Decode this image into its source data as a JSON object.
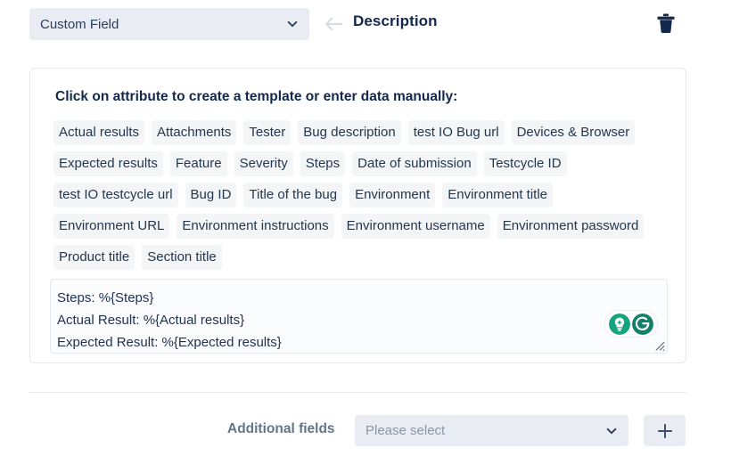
{
  "header": {
    "field_select_value": "Custom Field",
    "back_icon": "arrow-left-icon",
    "title": "Description",
    "delete_icon": "trash-icon"
  },
  "card": {
    "heading": "Click on attribute to create a template or enter data manually:",
    "attributes": [
      "Actual results",
      "Attachments",
      "Tester",
      "Bug description",
      "test IO Bug url",
      "Devices & Browser",
      "Expected results",
      "Feature",
      "Severity",
      "Steps",
      "Date of submission",
      "Testcycle ID",
      "test IO testcycle url",
      "Bug ID",
      "Title of the bug",
      "Environment",
      "Environment title",
      "Environment URL",
      "Environment instructions",
      "Environment username",
      "Environment password",
      "Product title",
      "Section title"
    ],
    "template_editor": {
      "value": "Steps: %{Steps}\nActual Result: %{Actual results}\nExpected Result: %{Expected results}",
      "extension_icons": [
        "lightbulb-icon",
        "grammarly-icon"
      ],
      "resize_handle": "resize-grip-icon"
    }
  },
  "footer": {
    "additional_fields_label": "Additional fields",
    "additional_fields_placeholder": "Please select",
    "add_button_icon": "plus-icon"
  },
  "colors": {
    "text_primary": "#12294d",
    "tag_background": "#f4f5f7",
    "select_background": "#e9ecf2",
    "accent_green": "#15a47e",
    "grammarly_green": "#15806a"
  }
}
